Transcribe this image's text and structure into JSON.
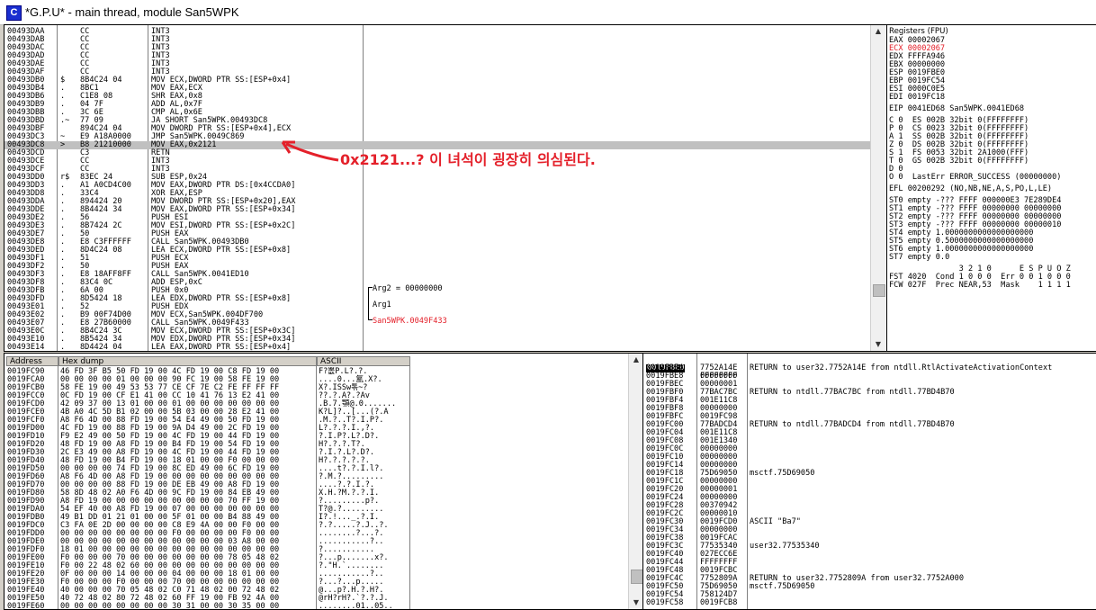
{
  "window": {
    "title": "*G.P.U* - main thread, module San5WPK",
    "icon_label": "C"
  },
  "cpu": {
    "addresses": [
      "00493DAA",
      "00493DAB",
      "00493DAC",
      "00493DAD",
      "00493DAE",
      "00493DAF",
      "00493DB0",
      "00493DB4",
      "00493DB6",
      "00493DB9",
      "00493DBB",
      "00493DBD",
      "00493DBF",
      "00493DC3",
      "00493DC8",
      "00493DCD",
      "00493DCE",
      "00493DCF",
      "00493DD0",
      "00493DD3",
      "00493DD8",
      "00493DDA",
      "00493DDE",
      "00493DE2",
      "00493DE3",
      "00493DE7",
      "00493DE8",
      "00493DED",
      "00493DF1",
      "00493DF2",
      "00493DF3",
      "00493DF8",
      "00493DFB",
      "00493DFD",
      "00493E01",
      "00493E02",
      "00493E07",
      "00493E0C",
      "00493E10",
      "00493E14"
    ],
    "marks": [
      "",
      " ",
      "",
      "",
      "",
      "",
      "$",
      ".",
      ".",
      ".",
      ".",
      ".~",
      "",
      "~",
      "> ",
      "",
      "",
      "",
      "r$",
      ".",
      ".",
      ".",
      ".",
      ".",
      ".",
      ".",
      ".",
      ".",
      ".",
      ".",
      ".",
      ".",
      ".",
      ".",
      ".",
      ".",
      ".",
      ".",
      ".",
      "."
    ],
    "hex": [
      "CC",
      "CC",
      "CC",
      "CC",
      "CC",
      "CC",
      "8B4C24 04",
      "8BC1",
      "C1E8 08",
      "04 7F",
      "3C 6E",
      "77 09",
      "894C24 04",
      "E9 A18A0000",
      "B8 21210000",
      "C3",
      "CC",
      "CC",
      "83EC 24",
      "A1 A0CD4C00",
      "33C4",
      "894424 20",
      "8B4424 34",
      "56",
      "8B7424 2C",
      "50",
      "E8 C3FFFFFF",
      "8D4C24 08",
      "51",
      "50",
      "E8 18AFF8FF",
      "83C4 0C",
      "6A 00",
      "8D5424 18",
      "52",
      "B9 00F74D00",
      "E8 27B60000",
      "8B4C24 3C",
      "8B5424 34",
      "8D4424 04"
    ],
    "asm": [
      "INT3",
      "INT3",
      "INT3",
      "INT3",
      "INT3",
      "INT3",
      "MOV ECX,DWORD PTR SS:[ESP+0x4]",
      "MOV EAX,ECX",
      "SHR EAX,0x8",
      "ADD AL,0x7F",
      "CMP AL,0x6E",
      "JA SHORT San5WPK.00493DC8",
      "MOV DWORD PTR SS:[ESP+0x4],ECX",
      "JMP San5WPK.0049C869",
      "MOV EAX,0x2121",
      "RETN",
      "INT3",
      "INT3",
      "SUB ESP,0x24",
      "MOV EAX,DWORD PTR DS:[0x4CCDA0]",
      "XOR EAX,ESP",
      "MOV DWORD PTR SS:[ESP+0x20],EAX",
      "MOV EAX,DWORD PTR SS:[ESP+0x34]",
      "PUSH ESI",
      "MOV ESI,DWORD PTR SS:[ESP+0x2C]",
      "PUSH EAX",
      "CALL San5WPK.00493DB0",
      "LEA ECX,DWORD PTR SS:[ESP+0x8]",
      "PUSH ECX",
      "PUSH EAX",
      "CALL San5WPK.0041ED10",
      "ADD ESP,0xC",
      "PUSH 0x0",
      "LEA EDX,DWORD PTR SS:[ESP+0x8]",
      "PUSH EDX",
      "MOV ECX,San5WPK.004DF700",
      "CALL San5WPK.0049F433",
      "MOV ECX,DWORD PTR SS:[ESP+0x3C]",
      "MOV EDX,DWORD PTR SS:[ESP+0x34]",
      "LEA EAX,DWORD PTR SS:[ESP+0x4]"
    ],
    "comments": {
      "arg2": "Arg2 = 00000000",
      "arg1": "Arg1",
      "callee": "San5WPK.0049F433"
    }
  },
  "annotation": "0x2121...? 이 녀석이 굉장히 의심된다.",
  "registers": {
    "header": "Registers (FPU)",
    "lines": [
      "EAX 00002067",
      "ECX 00002067",
      "EDX FFFFA946",
      "EBX 00000000",
      "ESP 0019FBE0",
      "EBP 0019FC54",
      "ESI 0000C0E5",
      "EDI 0019FC18",
      "",
      "EIP 0041ED68 San5WPK.0041ED68",
      "",
      "C 0  ES 002B 32bit 0(FFFFFFFF)",
      "P 0  CS 0023 32bit 0(FFFFFFFF)",
      "A 1  SS 002B 32bit 0(FFFFFFFF)",
      "Z 0  DS 002B 32bit 0(FFFFFFFF)",
      "S 1  FS 0053 32bit 2A1000(FFF)",
      "T 0  GS 002B 32bit 0(FFFFFFFF)",
      "D 0",
      "O 0  LastErr ERROR_SUCCESS (00000000)",
      "",
      "EFL 00200292 (NO,NB,NE,A,S,PO,L,LE)",
      "",
      "ST0 empty -??? FFFF 000000E3 7E289DE4",
      "ST1 empty -??? FFFF 00000000 00000000",
      "ST2 empty -??? FFFF 00000000 00000000",
      "ST3 empty -??? FFFF 00000000 00000010",
      "ST4 empty 1.0000000000000000000",
      "ST5 empty 0.5000000000000000000",
      "ST6 empty 1.0000000000000000000",
      "ST7 empty 0.0",
      "",
      "               3 2 1 0      E S P U O Z",
      "FST 4020  Cond 1 0 0 0  Err 0 0 1 0 0 0",
      "FCW 027F  Prec NEAR,53  Mask    1 1 1 1"
    ]
  },
  "dump": {
    "headers": {
      "address": "Address",
      "hex": "Hex dump",
      "ascii": "ASCII"
    },
    "addresses": [
      "0019FC90",
      "0019FCA0",
      "0019FCB0",
      "0019FCC0",
      "0019FCD0",
      "0019FCE0",
      "0019FCF0",
      "0019FD00",
      "0019FD10",
      "0019FD20",
      "0019FD30",
      "0019FD40",
      "0019FD50",
      "0019FD60",
      "0019FD70",
      "0019FD80",
      "0019FD90",
      "0019FDA0",
      "0019FDB0",
      "0019FDC0",
      "0019FDD0",
      "0019FDE0",
      "0019FDF0",
      "0019FE00",
      "0019FE10",
      "0019FE20",
      "0019FE30",
      "0019FE40",
      "0019FE50",
      "0019FE60"
    ],
    "hex": [
      "46 FD 3F B5 50 FD 19 00 4C FD 19 00 C8 FD 19 00",
      "00 00 00 00 01 00 00 00 90 FC 19 00 58 FE 19 00",
      "58 FE 19 00 49 53 53 77 CE CF 7E C2 FE FF FF FF",
      "0C FD 19 00 CF E1 41 00 CC 10 41 76 13 E2 41 00",
      "42 09 37 00 13 01 00 00 01 00 00 00 00 00 00 00",
      "4B A0 4C 5D B1 02 00 00 5B 03 00 00 28 E2 41 00",
      "A8 F6 4D 00 88 FD 19 00 54 E4 49 00 50 FD 19 00",
      "4C FD 19 00 88 FD 19 00 9A D4 49 00 2C FD 19 00",
      "F9 E2 49 00 50 FD 19 00 4C FD 19 00 44 FD 19 00",
      "48 FD 19 00 A8 FD 19 00 B4 FD 19 00 54 FD 19 00",
      "2C E3 49 00 A8 FD 19 00 4C FD 19 00 44 FD 19 00",
      "48 FD 19 00 B4 FD 19 00 18 01 00 00 F0 00 00 00",
      "00 00 00 00 74 FD 19 00 8C ED 49 00 6C FD 19 00",
      "A8 F6 4D 00 A8 FD 19 00 00 00 00 00 00 00 00 00",
      "00 00 00 00 88 FD 19 00 DE EB 49 00 A8 FD 19 00",
      "58 8D 48 02 A0 F6 4D 00 9C FD 19 00 84 EB 49 00",
      "A8 FD 19 00 00 00 00 00 00 00 00 00 70 FF 19 00",
      "54 EF 40 00 A8 FD 19 00 07 00 00 00 00 00 00 00",
      "49 B1 DD 01 21 01 00 00 5F 01 00 00 B4 88 49 00",
      "C3 FA 0E 2D 00 00 00 00 C8 E9 4A 00 00 F0 00 00",
      "00 00 00 00 00 00 00 00 F0 00 00 00 00 F0 00 00",
      "00 00 00 00 00 00 00 00 00 00 00 00 03 A8 00 00",
      "18 01 00 00 00 00 00 00 00 00 00 00 00 00 00 00",
      "F0 00 00 00 70 00 00 00 00 00 00 00 78 05 48 02",
      "F0 00 22 48 02 60 00 00 00 00 00 00 00 00 00 00",
      "0F 00 00 00 14 00 00 00 04 00 00 00 18 01 00 00",
      "F0 00 00 00 F0 00 00 00 70 00 00 00 00 00 00 00",
      "40 00 00 00 70 05 48 02 C0 71 48 02 00 72 48 02",
      "40 72 48 02 80 72 48 02 60 FF 19 00 FB 92 4A 00",
      "00 00 00 00 00 00 00 00 30 31 00 00 30 35 00 00"
    ],
    "ascii": [
      "F?뽒P.L?.?.",
      "....0...氳.X?.",
      "X?.ISSw톢~?",
      "??.?.A?.?Av",
      ".B.7.顎@.0.......",
      "K?L]?..[...(?.A",
      ".M.?..T?.I.P?.",
      "L?.?.?.I.,?.",
      "?.I.P?.L?.D?.",
      "H?.?.?.T?.",
      "?.I.?.L?.D?.",
      "H?.?.?.?.?.",
      "....t?.?.I.l?.",
      "?.M.?.........",
      "....?.?.I.?.",
      "X.H.?M.?.?.I.",
      "?.........p?.",
      "T?@.?.........",
      "I?.!..._.?.I.",
      "?.?.....?.J..?.",
      "........?...?.",
      "...........?..",
      "?...........",
      "?...p.......x?.",
      "?.\"H.`........",
      "...........?..",
      "?...?...p.....",
      "@...p?.H.?.H?.",
      "@rH?rH?.`?.?.J.",
      "........01..05.."
    ]
  },
  "stack": {
    "header_addr": "0019FBE0",
    "header_val": "FFFFFFFF",
    "addresses": [
      "0019FBE4",
      "0019FBE8",
      "0019FBEC",
      "0019FBF0",
      "0019FBF4",
      "0019FBF8",
      "0019FBFC",
      "0019FC00",
      "0019FC04",
      "0019FC08",
      "0019FC0C",
      "0019FC10",
      "0019FC14",
      "0019FC18",
      "0019FC1C",
      "0019FC20",
      "0019FC24",
      "0019FC28",
      "0019FC2C",
      "0019FC30",
      "0019FC34",
      "0019FC38",
      "0019FC3C",
      "0019FC40",
      "0019FC44",
      "0019FC48",
      "0019FC4C",
      "0019FC50",
      "0019FC54",
      "0019FC58"
    ],
    "values": [
      "7752A14E",
      "00000000",
      "00000001",
      "77BAC7BC",
      "001E11C8",
      "00000000",
      "0019FC98",
      "77BADCD4",
      "001E11C8",
      "001E1340",
      "00000000",
      "00000000",
      "00000000",
      "75D69050",
      "00000000",
      "00000001",
      "00000000",
      "00370942",
      "00000010",
      "0019FCD0",
      "00000000",
      "0019FCAC",
      "77535340",
      "027ECC6E",
      "FFFFFFFF",
      "0019FCBC",
      "7752809A",
      "75D69050",
      "758124D7",
      "0019FCB8"
    ],
    "comments": [
      "RETURN to user32.7752A14E from ntdll.RtlActivateActivationContext",
      "",
      "",
      "RETURN to ntdll.77BAC7BC from ntdll.77BD4B70",
      "",
      "",
      "",
      "RETURN to ntdll.77BADCD4 from ntdll.77BD4B70",
      "",
      "",
      "",
      "",
      "",
      "msctf.75D69050",
      "",
      "",
      "",
      "",
      "",
      "ASCII \"Ba7\"",
      "",
      "",
      "user32.77535340",
      "",
      "",
      "",
      "RETURN to user32.7752809A from user32.7752A000",
      "msctf.75D69050",
      "",
      ""
    ]
  }
}
